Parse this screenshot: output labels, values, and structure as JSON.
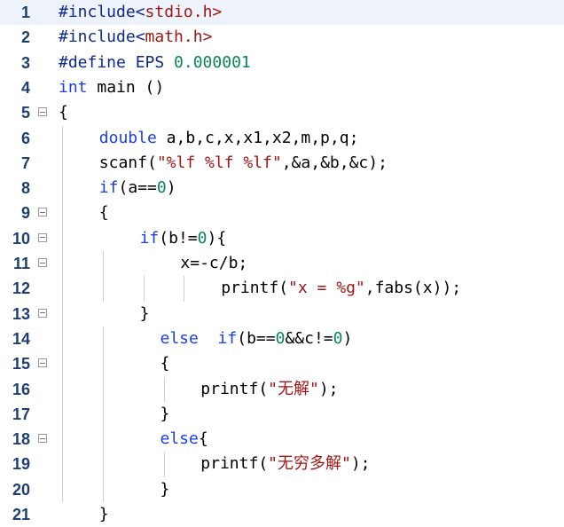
{
  "editor": {
    "language": "C",
    "highlight_color": "#eef3fb",
    "lines": [
      {
        "n": "1",
        "indent": 0,
        "fold": false,
        "current": true,
        "tokens": [
          {
            "t": "#include<",
            "c": "pp"
          },
          {
            "t": "stdio.h>",
            "c": "str"
          }
        ]
      },
      {
        "n": "2",
        "indent": 0,
        "fold": false,
        "tokens": [
          {
            "t": "#include<",
            "c": "pp"
          },
          {
            "t": "math.h>",
            "c": "str"
          }
        ]
      },
      {
        "n": "3",
        "indent": 0,
        "fold": false,
        "tokens": [
          {
            "t": "#define EPS ",
            "c": "pp"
          },
          {
            "t": "0.000001",
            "c": "num"
          }
        ]
      },
      {
        "n": "4",
        "indent": 0,
        "fold": false,
        "tokens": [
          {
            "t": "int",
            "c": "kw"
          },
          {
            "t": " main ()",
            "c": ""
          }
        ]
      },
      {
        "n": "5",
        "indent": 0,
        "fold": true,
        "tokens": [
          {
            "t": "{",
            "c": ""
          }
        ]
      },
      {
        "n": "6",
        "indent": 4,
        "fold": false,
        "tokens": [
          {
            "t": "double",
            "c": "kw"
          },
          {
            "t": " a,b,c,x,x1,x2,m,p,q;",
            "c": ""
          }
        ]
      },
      {
        "n": "7",
        "indent": 4,
        "fold": false,
        "tokens": [
          {
            "t": "scanf(",
            "c": ""
          },
          {
            "t": "\"%lf %lf %lf\"",
            "c": "str"
          },
          {
            "t": ",&a,&b,&c);",
            "c": ""
          }
        ]
      },
      {
        "n": "8",
        "indent": 4,
        "fold": false,
        "tokens": [
          {
            "t": "if",
            "c": "kw"
          },
          {
            "t": "(a==",
            "c": ""
          },
          {
            "t": "0",
            "c": "num"
          },
          {
            "t": ")",
            "c": ""
          }
        ]
      },
      {
        "n": "9",
        "indent": 4,
        "fold": true,
        "tokens": [
          {
            "t": "{",
            "c": ""
          }
        ]
      },
      {
        "n": "10",
        "indent": 8,
        "fold": true,
        "tokens": [
          {
            "t": "if",
            "c": "kw"
          },
          {
            "t": "(b!=",
            "c": ""
          },
          {
            "t": "0",
            "c": "num"
          },
          {
            "t": "){",
            "c": ""
          }
        ]
      },
      {
        "n": "11",
        "indent": 12,
        "fold": true,
        "tokens": [
          {
            "t": "x=-c/b;",
            "c": ""
          }
        ]
      },
      {
        "n": "12",
        "indent": 16,
        "fold": false,
        "tokens": [
          {
            "t": "printf(",
            "c": ""
          },
          {
            "t": "\"x = %g\"",
            "c": "str"
          },
          {
            "t": ",fabs(x));",
            "c": ""
          }
        ]
      },
      {
        "n": "13",
        "indent": 8,
        "fold": true,
        "tokens": [
          {
            "t": "}",
            "c": ""
          }
        ]
      },
      {
        "n": "14",
        "indent": 10,
        "fold": false,
        "tokens": [
          {
            "t": "else",
            "c": "kw"
          },
          {
            "t": "  ",
            "c": ""
          },
          {
            "t": "if",
            "c": "kw"
          },
          {
            "t": "(b==",
            "c": ""
          },
          {
            "t": "0",
            "c": "num"
          },
          {
            "t": "&&c!=",
            "c": ""
          },
          {
            "t": "0",
            "c": "num"
          },
          {
            "t": ")",
            "c": ""
          }
        ]
      },
      {
        "n": "15",
        "indent": 10,
        "fold": true,
        "tokens": [
          {
            "t": "{",
            "c": ""
          }
        ]
      },
      {
        "n": "16",
        "indent": 14,
        "fold": false,
        "tokens": [
          {
            "t": "printf(",
            "c": ""
          },
          {
            "t": "\"无解\"",
            "c": "str"
          },
          {
            "t": ");",
            "c": ""
          }
        ]
      },
      {
        "n": "17",
        "indent": 10,
        "fold": false,
        "tokens": [
          {
            "t": "}",
            "c": ""
          }
        ]
      },
      {
        "n": "18",
        "indent": 10,
        "fold": true,
        "tokens": [
          {
            "t": "else",
            "c": "kw"
          },
          {
            "t": "{",
            "c": ""
          }
        ]
      },
      {
        "n": "19",
        "indent": 14,
        "fold": false,
        "tokens": [
          {
            "t": "printf(",
            "c": ""
          },
          {
            "t": "\"无穷多解\"",
            "c": "str"
          },
          {
            "t": ");",
            "c": ""
          }
        ]
      },
      {
        "n": "20",
        "indent": 10,
        "fold": false,
        "tokens": [
          {
            "t": "}",
            "c": ""
          }
        ]
      },
      {
        "n": "21",
        "indent": 4,
        "fold": false,
        "tokens": [
          {
            "t": "}",
            "c": ""
          }
        ]
      }
    ]
  }
}
